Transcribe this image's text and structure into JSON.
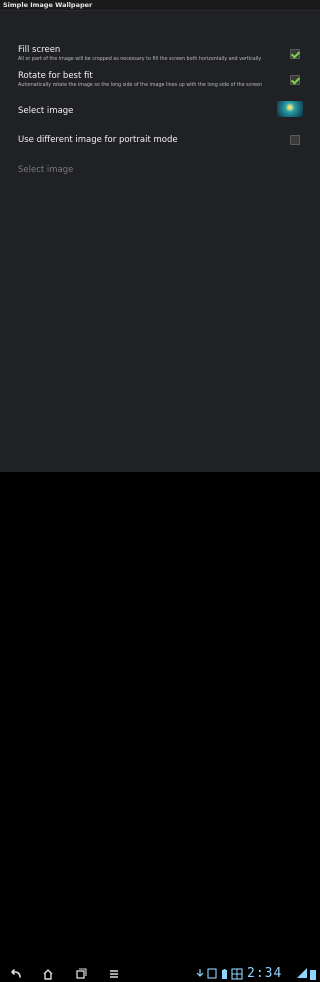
{
  "window": {
    "title": "Simple Image Wallpaper"
  },
  "preferences": {
    "fill_screen": {
      "title": "Fill screen",
      "summary": "All or part of the image will be cropped as necessary to fill the screen both horizontally and vertically",
      "checked": true
    },
    "rotate_for_best_fit": {
      "title": "Rotate for best fit",
      "summary": "Automatically rotate the image so the long side of the image lines up with the long side of the screen",
      "checked": true
    },
    "select_image": {
      "title": "Select image"
    },
    "use_different_image_portrait": {
      "title": "Use different image for portrait mode",
      "checked": false
    },
    "select_image_portrait": {
      "title": "Select image"
    }
  },
  "navigation": {
    "icons": [
      "back-icon",
      "home-icon",
      "recent-apps-icon",
      "menu-icon"
    ]
  },
  "status_bar": {
    "time": "2:34",
    "icons": [
      "download-icon",
      "notification-icon",
      "battery-icon",
      "wifi-icon"
    ]
  },
  "colors": {
    "accent": "#7cd34a",
    "clock": "#8fd3ff",
    "background": "#202124"
  }
}
